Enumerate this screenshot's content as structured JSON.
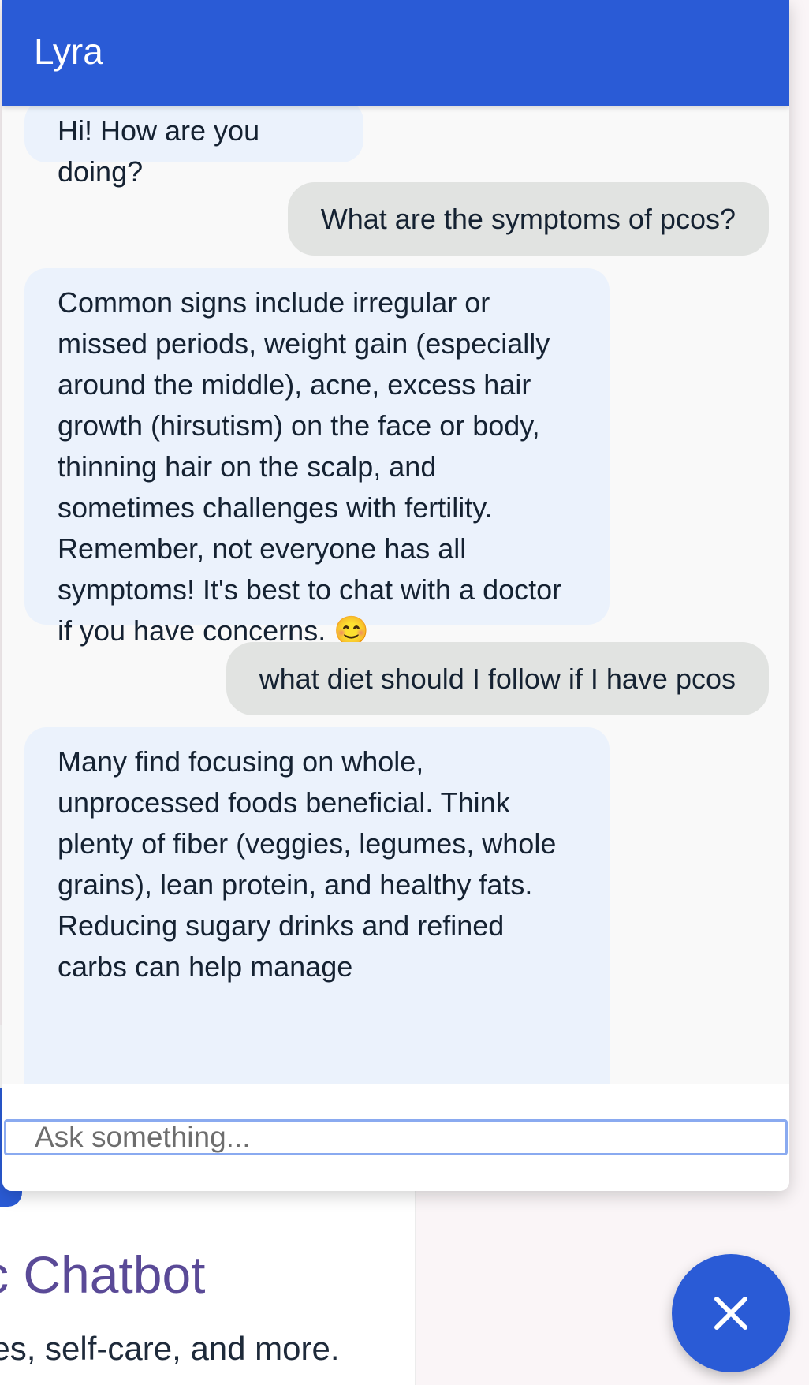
{
  "page": {
    "title_fragment": "c Chatbot",
    "subtitle_fragment": "nes, self-care, and more."
  },
  "chat": {
    "title": "Lyra",
    "messages": [
      {
        "role": "bot",
        "text": "Hi! How are you doing?"
      },
      {
        "role": "user",
        "text": "What are the symptoms of pcos?"
      },
      {
        "role": "bot",
        "text": "Common signs include irregular or missed periods, weight gain (especially around the middle), acne, excess hair growth (hirsutism) on the face or body, thinning hair on the scalp, and sometimes challenges with fertility. Remember, not everyone has all symptoms! It's best to chat with a doctor if you have concerns. 😊"
      },
      {
        "role": "user",
        "text": "what diet should I follow if I have pcos"
      },
      {
        "role": "bot",
        "text": "Many find focusing on whole, unprocessed foods beneficial. Think plenty of fiber (veggies, legumes, whole grains), lean protein, and healthy fats. Reducing sugary drinks and refined carbs can help manage"
      }
    ],
    "input_placeholder": "Ask something...",
    "close_icon": "close-icon"
  },
  "colors": {
    "primary": "#2a5bd6",
    "bot_bubble": "#ebf2fc",
    "user_bubble": "#e1e3e1",
    "heading": "#5a4a97"
  }
}
